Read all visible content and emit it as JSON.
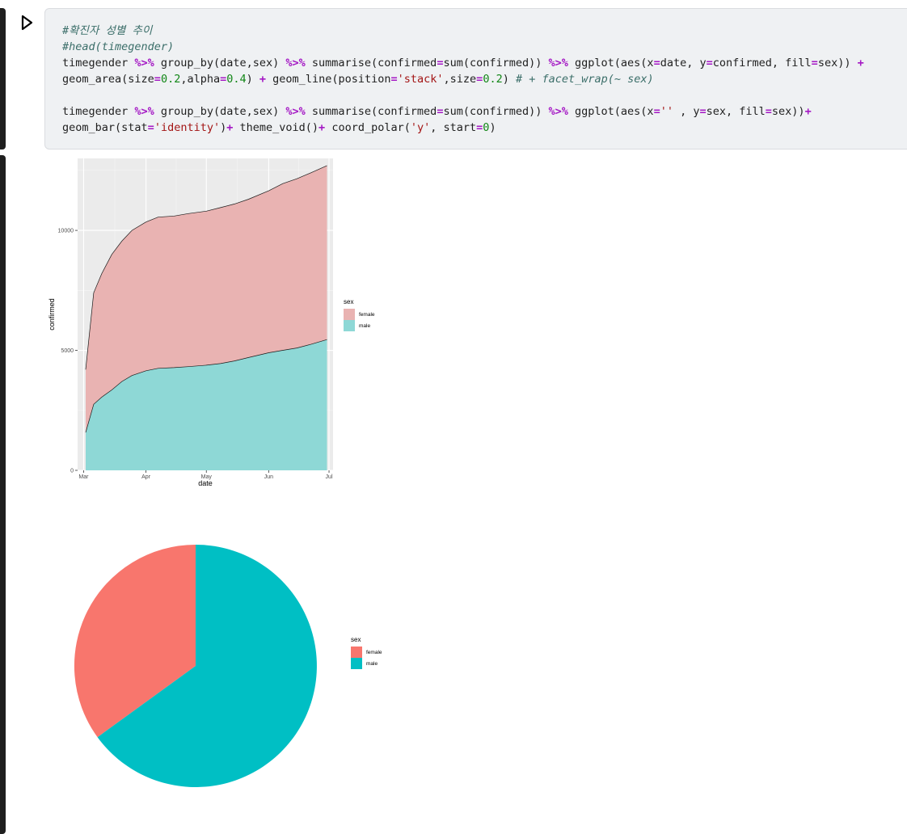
{
  "cell": {
    "code_lines": [
      [
        {
          "t": "#확진자 성별 추이",
          "c": "cm"
        }
      ],
      [
        {
          "t": "#head(timegender)",
          "c": "cm"
        }
      ],
      [
        {
          "t": "timegender "
        },
        {
          "t": "%>%",
          "c": "op"
        },
        {
          "t": " group_by(date,sex) "
        },
        {
          "t": "%>%",
          "c": "op"
        },
        {
          "t": " summarise(confirmed"
        },
        {
          "t": "=",
          "c": "op"
        },
        {
          "t": "sum(confirmed)) "
        },
        {
          "t": "%>%",
          "c": "op"
        },
        {
          "t": " ggplot(aes(x"
        },
        {
          "t": "=",
          "c": "op"
        },
        {
          "t": "date, y"
        },
        {
          "t": "=",
          "c": "op"
        },
        {
          "t": "confirmed, fill"
        },
        {
          "t": "=",
          "c": "op"
        },
        {
          "t": "sex)) "
        },
        {
          "t": "+",
          "c": "op"
        }
      ],
      [
        {
          "t": "geom_area(size"
        },
        {
          "t": "=",
          "c": "op"
        },
        {
          "t": "0.2",
          "c": "num"
        },
        {
          "t": ",alpha"
        },
        {
          "t": "=",
          "c": "op"
        },
        {
          "t": "0.4",
          "c": "num"
        },
        {
          "t": ") "
        },
        {
          "t": "+",
          "c": "op"
        },
        {
          "t": " geom_line(position"
        },
        {
          "t": "=",
          "c": "op"
        },
        {
          "t": "'stack'",
          "c": "str"
        },
        {
          "t": ",size"
        },
        {
          "t": "=",
          "c": "op"
        },
        {
          "t": "0.2",
          "c": "num"
        },
        {
          "t": ") "
        },
        {
          "t": "# + facet_wrap(~ sex)",
          "c": "cm"
        }
      ],
      [
        {
          "t": ""
        }
      ],
      [
        {
          "t": "timegender "
        },
        {
          "t": "%>%",
          "c": "op"
        },
        {
          "t": " group_by(date,sex) "
        },
        {
          "t": "%>%",
          "c": "op"
        },
        {
          "t": " summarise(confirmed"
        },
        {
          "t": "=",
          "c": "op"
        },
        {
          "t": "sum(confirmed)) "
        },
        {
          "t": "%>%",
          "c": "op"
        },
        {
          "t": " ggplot(aes(x"
        },
        {
          "t": "=",
          "c": "op"
        },
        {
          "t": "'' ",
          "c": "str"
        },
        {
          "t": ", y"
        },
        {
          "t": "=",
          "c": "op"
        },
        {
          "t": "sex, fill"
        },
        {
          "t": "=",
          "c": "op"
        },
        {
          "t": "sex))"
        },
        {
          "t": "+",
          "c": "op"
        }
      ],
      [
        {
          "t": "geom_bar(stat"
        },
        {
          "t": "=",
          "c": "op"
        },
        {
          "t": "'identity'",
          "c": "str"
        },
        {
          "t": ")"
        },
        {
          "t": "+",
          "c": "op"
        },
        {
          "t": " theme_void()"
        },
        {
          "t": "+",
          "c": "op"
        },
        {
          "t": " coord_polar("
        },
        {
          "t": "'y'",
          "c": "str"
        },
        {
          "t": ", start"
        },
        {
          "t": "=",
          "c": "op"
        },
        {
          "t": "0",
          "c": "num"
        },
        {
          "t": ")"
        }
      ]
    ]
  },
  "colors": {
    "female": "#F8766D",
    "male": "#00BFC4",
    "female_area": "#E9B3B2",
    "male_area": "#8ED8D6",
    "panel": "#EBEBEB"
  },
  "chart_data": [
    {
      "type": "area",
      "stacked": true,
      "xlabel": "date",
      "ylabel": "confirmed",
      "x_ticks": [
        "Mar",
        "Apr",
        "May",
        "Jun",
        "Jul"
      ],
      "x_tick_dates": [
        "2020-03-01",
        "2020-04-01",
        "2020-05-01",
        "2020-06-01",
        "2020-07-01"
      ],
      "ylim": [
        0,
        13000
      ],
      "y_ticks": [
        0,
        5000,
        10000
      ],
      "legend": {
        "title": "sex",
        "entries": [
          "female",
          "male"
        ],
        "placement": "right"
      },
      "x": [
        "2020-03-02",
        "2020-03-06",
        "2020-03-10",
        "2020-03-15",
        "2020-03-20",
        "2020-03-25",
        "2020-04-01",
        "2020-04-07",
        "2020-04-15",
        "2020-04-22",
        "2020-05-01",
        "2020-05-08",
        "2020-05-15",
        "2020-05-22",
        "2020-06-01",
        "2020-06-08",
        "2020-06-15",
        "2020-06-22",
        "2020-06-30"
      ],
      "series": [
        {
          "name": "male",
          "values": [
            1580,
            2750,
            3050,
            3350,
            3700,
            3950,
            4150,
            4250,
            4280,
            4320,
            4380,
            4450,
            4560,
            4700,
            4900,
            5000,
            5100,
            5250,
            5450
          ]
        },
        {
          "name": "female",
          "values": [
            2620,
            4650,
            5150,
            5650,
            5850,
            6050,
            6200,
            6300,
            6320,
            6380,
            6420,
            6500,
            6540,
            6600,
            6750,
            6950,
            7050,
            7150,
            7250
          ]
        }
      ]
    },
    {
      "type": "pie",
      "legend": {
        "title": "sex",
        "entries": [
          "female",
          "male"
        ],
        "placement": "right"
      },
      "slices": [
        {
          "name": "female",
          "value": 35
        },
        {
          "name": "male",
          "value": 65
        }
      ]
    }
  ]
}
